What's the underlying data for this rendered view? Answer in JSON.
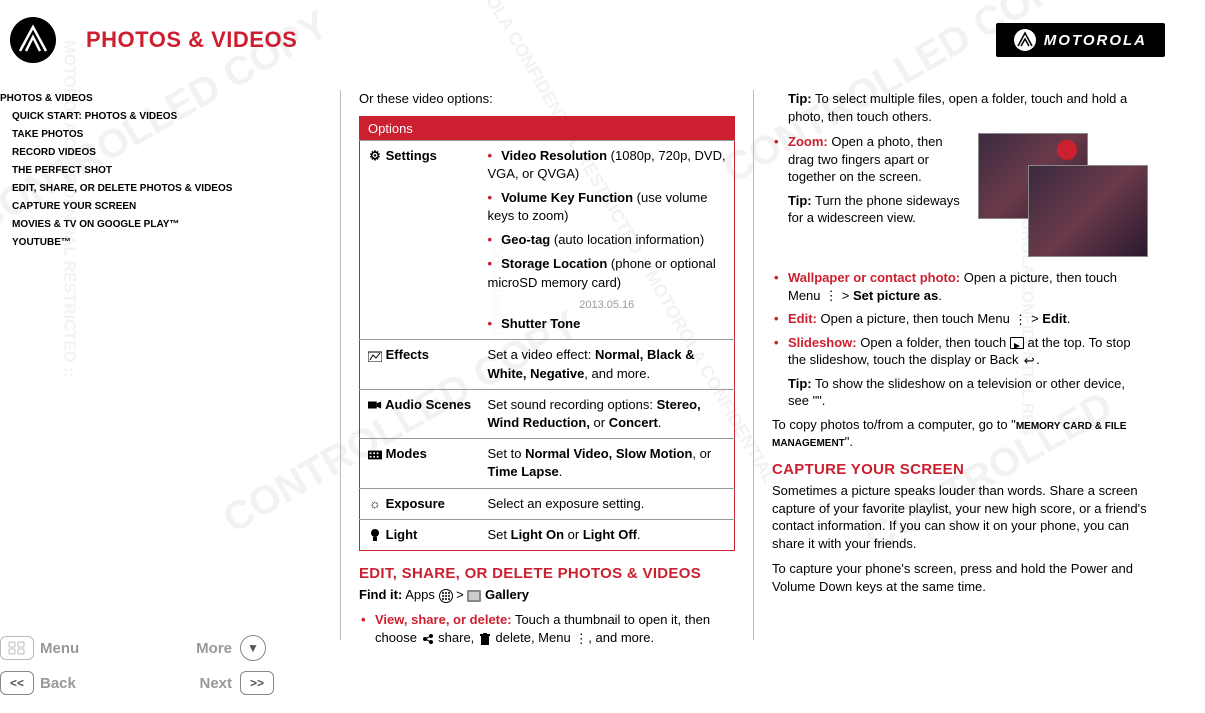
{
  "header": {
    "title": "PHOTOS & VIDEOS",
    "brand": "MOTOROLA"
  },
  "sidebar": {
    "items": [
      {
        "label": "PHOTOS & VIDEOS",
        "indent": false
      },
      {
        "label": "QUICK START: PHOTOS & VIDEOS",
        "indent": true
      },
      {
        "label": "TAKE PHOTOS",
        "indent": true
      },
      {
        "label": "RECORD VIDEOS",
        "indent": true
      },
      {
        "label": "THE PERFECT SHOT",
        "indent": true
      },
      {
        "label": "EDIT, SHARE, OR DELETE PHOTOS & VIDEOS",
        "indent": true
      },
      {
        "label": "CAPTURE YOUR SCREEN",
        "indent": true
      },
      {
        "label": "MOVIES & TV ON GOOGLE PLAY™",
        "indent": true
      },
      {
        "label": "YOUTUBE™",
        "indent": true
      }
    ]
  },
  "col1": {
    "intro": "Or these video options:",
    "table_header": "Options",
    "rows": {
      "settings": {
        "label": "Settings",
        "items": [
          {
            "b": "Video Resolution",
            "t": " (1080p, 720p, DVD, VGA, or QVGA)"
          },
          {
            "b": "Volume Key Function",
            "t": " (use volume keys to zoom)"
          },
          {
            "b": "Geo-tag",
            "t": " (auto location information)"
          },
          {
            "b": "Storage Location",
            "t": " (phone or optional microSD memory card)"
          },
          {
            "b": "Shutter Tone",
            "t": ""
          }
        ]
      },
      "effects": {
        "label": "Effects",
        "text_pre": "Set a video effect: ",
        "bold": "Normal, Black & White, Negative",
        "text_post": ", and more."
      },
      "audio": {
        "label": "Audio Scenes",
        "text_pre": "Set sound recording options: ",
        "bold": "Stereo, Wind Reduction,",
        "text_post": " or ",
        "bold2": "Concert",
        "text_end": "."
      },
      "modes": {
        "label": "Modes",
        "text_pre": "Set to ",
        "bold": "Normal Video, Slow Motion",
        "text_post": ", or ",
        "bold2": "Time Lapse",
        "text_end": "."
      },
      "exposure": {
        "label": "Exposure",
        "text": "Select an exposure setting."
      },
      "light": {
        "label": "Light",
        "text_pre": "Set ",
        "bold": "Light On",
        "text_mid": " or ",
        "bold2": "Light Off",
        "text_end": "."
      }
    },
    "section_h": "EDIT, SHARE, OR DELETE PHOTOS & VIDEOS",
    "findit_label": "Find it:",
    "findit_path_1": "Apps",
    "findit_path_2": "Gallery",
    "view": {
      "label": "View, share, or delete:",
      "text": " Touch a thumbnail to open it, then choose ",
      "share": " share, ",
      "delete": " delete, Menu ",
      "end": ", and more."
    }
  },
  "col2": {
    "tip1_label": "Tip:",
    "tip1_text": " To select multiple files, open a folder, touch and hold a photo, then touch others.",
    "zoom": {
      "label": "Zoom:",
      "text": " Open a photo, then drag two fingers apart or together on the screen."
    },
    "tip2_label": "Tip:",
    "tip2_text": " Turn the phone sideways for a widescreen view.",
    "wallpaper": {
      "label": "Wallpaper or contact photo:",
      "text": " Open a picture, then touch Menu ",
      "arrow": " > ",
      "bold": "Set picture as",
      "end": "."
    },
    "edit": {
      "label": "Edit:",
      "text": " Open a picture, then touch Menu ",
      "arrow": " > ",
      "bold": "Edit",
      "end": "."
    },
    "slideshow": {
      "label": "Slideshow:",
      "text": " Open a folder, then touch ",
      "text2": " at the top. To stop the slideshow, touch the display or Back ",
      "end": "."
    },
    "tip3_label": "Tip:",
    "tip3_text": " To show the slideshow on a television or other device, see \"\".",
    "copy_pre": "To copy photos to/from a computer, go to \"",
    "copy_link": "MEMORY CARD & FILE MANAGEMENT",
    "copy_post": "\".",
    "capture_h": "CAPTURE YOUR SCREEN",
    "capture_p1": "Sometimes a picture speaks louder than words. Share a screen capture of your favorite playlist, your new high score, or a friend's contact information. If you can show it on your phone, you can share it with your friends.",
    "capture_p2": "To capture your phone's screen, press and hold the Power and Volume Down keys at the same time."
  },
  "footer": {
    "menu": "Menu",
    "more": "More",
    "back": "Back",
    "next": "Next"
  },
  "watermark_center": "2013.05.16"
}
